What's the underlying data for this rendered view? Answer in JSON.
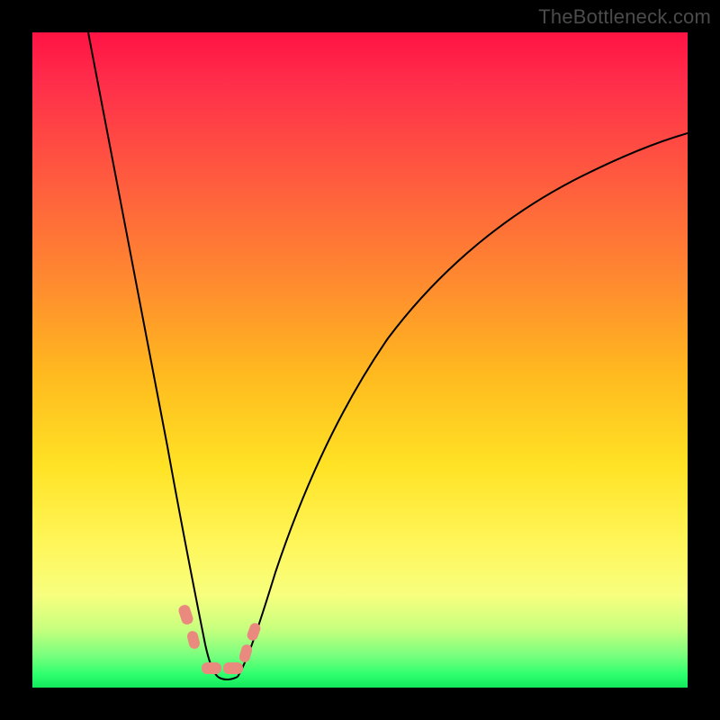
{
  "watermark": "TheBottleneck.com",
  "chart_data": {
    "type": "line",
    "title": "",
    "xlabel": "",
    "ylabel": "",
    "xlim": [
      0,
      100
    ],
    "ylim": [
      0,
      100
    ],
    "series": [
      {
        "name": "left-branch",
        "x": [
          8,
          10,
          12,
          14,
          16,
          18,
          20,
          22,
          24,
          25,
          26
        ],
        "y": [
          100,
          88,
          76,
          64,
          52,
          40,
          28,
          18,
          10,
          6,
          3
        ]
      },
      {
        "name": "trough",
        "x": [
          26,
          28,
          30,
          31
        ],
        "y": [
          3,
          2,
          2,
          3
        ]
      },
      {
        "name": "right-branch",
        "x": [
          31,
          34,
          38,
          44,
          52,
          62,
          74,
          86,
          98,
          100
        ],
        "y": [
          3,
          10,
          22,
          36,
          50,
          62,
          72,
          79,
          84,
          85
        ]
      }
    ],
    "markers": [
      {
        "x": 23.5,
        "y": 9.5
      },
      {
        "x": 24.5,
        "y": 6.0
      },
      {
        "x": 27.0,
        "y": 2.5
      },
      {
        "x": 29.5,
        "y": 2.5
      },
      {
        "x": 31.5,
        "y": 4.5
      },
      {
        "x": 32.5,
        "y": 7.5
      }
    ],
    "grid": false,
    "legend": false
  }
}
